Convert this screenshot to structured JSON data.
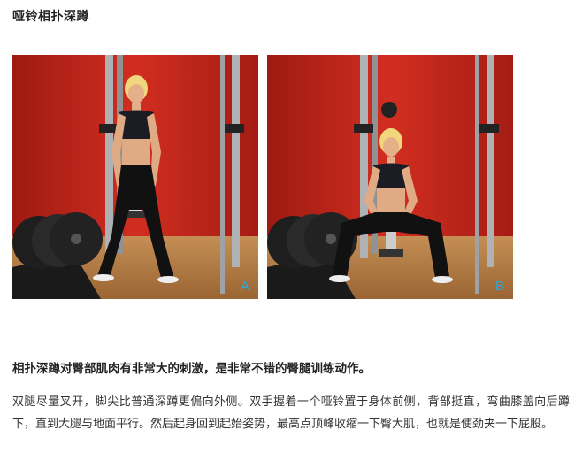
{
  "title": "哑铃相扑深蹲",
  "images": [
    {
      "label": "A",
      "pose": "standing"
    },
    {
      "label": "B",
      "pose": "squat"
    }
  ],
  "colors": {
    "wall": "#c8261b",
    "floor": "#b98249",
    "rack": "#a9adb0",
    "label": "#29a9e0"
  },
  "headline": "相扑深蹲对臀部肌肉有非常大的刺激，是非常不错的臀腿训练动作。",
  "description": "双腿尽量叉开，脚尖比普通深蹲更偏向外侧。双手握着一个哑铃置于身体前侧，背部挺直，弯曲膝盖向后蹲下，直到大腿与地面平行。然后起身回到起始姿势，最高点顶峰收缩一下臀大肌，也就是使劲夹一下屁股。"
}
